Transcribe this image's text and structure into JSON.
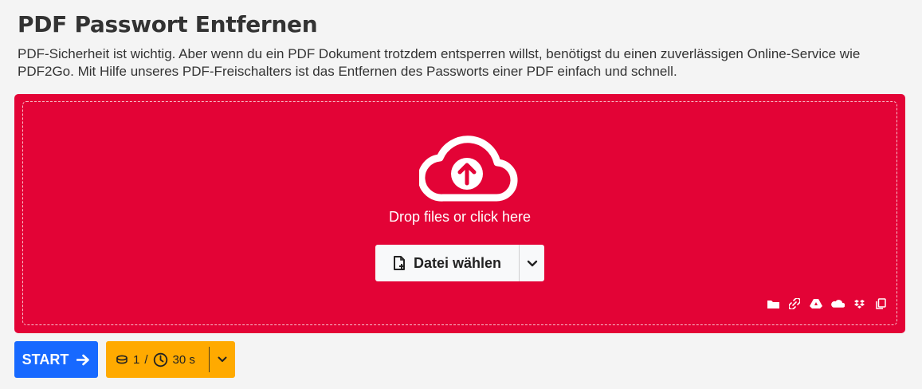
{
  "header": {
    "title": "PDF Passwort Entfernen",
    "description": "PDF-Sicherheit ist wichtig. Aber wenn du ein PDF Dokument trotzdem entsperren willst, benötigst du einen zuverlässigen Online-Service wie PDF2Go. Mit Hilfe unseres PDF-Freischalters ist das Entfernen des Passworts einer PDF einfach und schnell."
  },
  "upload": {
    "icon": "cloud-upload-icon",
    "drop_text": "Drop files or click here",
    "choose_label": "Datei wählen",
    "sources": [
      "folder-icon",
      "link-icon",
      "google-drive-icon",
      "onedrive-icon",
      "dropbox-icon",
      "clipboard-icon"
    ]
  },
  "actions": {
    "start_label": "START",
    "credits": "1",
    "credits_sep": "/",
    "time": "30 s"
  },
  "colors": {
    "dropzone": "#e30336",
    "start": "#1769ff",
    "credit": "#ffaa00"
  }
}
